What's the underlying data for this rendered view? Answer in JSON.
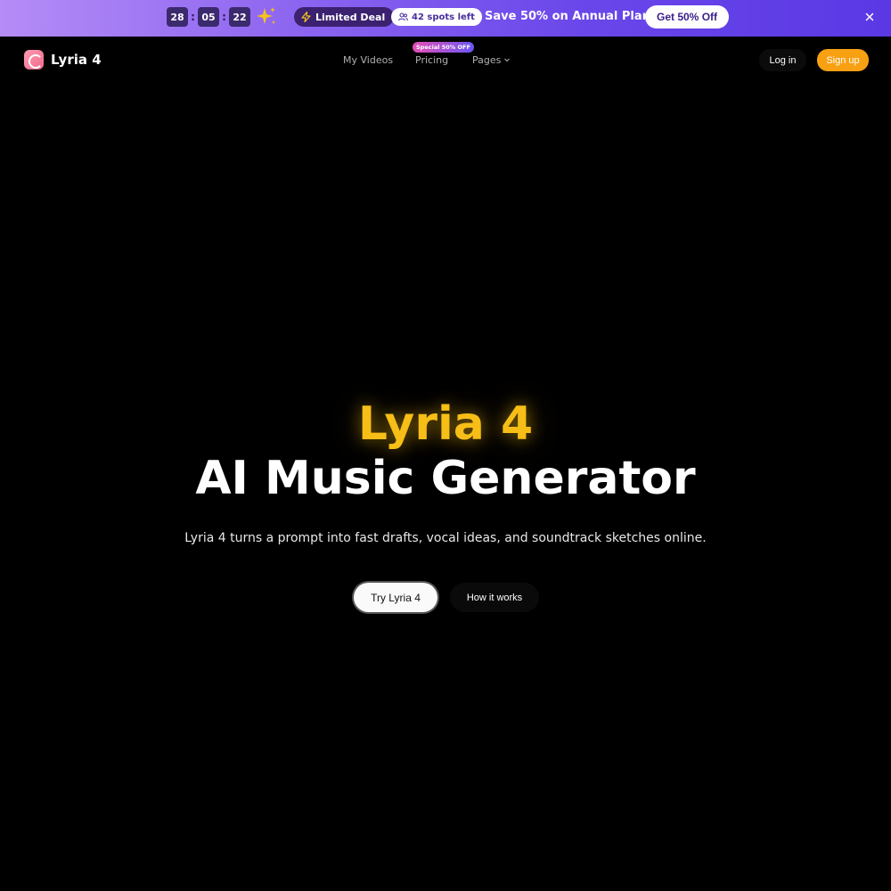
{
  "promo": {
    "timer": {
      "hours": "28",
      "minutes": "05",
      "seconds": "22",
      "separator": ":"
    },
    "deal_label": "Limited Deal",
    "spots_label": "42 spots left",
    "headline": "Save 50% on Annual Plans",
    "cta_label": "Get 50% Off",
    "icons": {
      "sparkle": "sparkle-icon",
      "bolt": "bolt-icon",
      "users": "users-icon",
      "close": "close-icon"
    },
    "colors": {
      "sparkle": "#f7c21b",
      "gradient_start": "#b58cf6",
      "gradient_end": "#5a38e4"
    }
  },
  "nav": {
    "brand": "Lyria 4",
    "links": {
      "my_videos": "My Videos",
      "pricing": "Pricing",
      "pricing_badge": "Special 50% OFF",
      "pages": "Pages"
    },
    "login_label": "Log in",
    "signup_label": "Sign up",
    "colors": {
      "signup": "#f7a012"
    }
  },
  "hero": {
    "brand_line": "Lyria 4",
    "title": "AI Music Generator",
    "subtitle": "Lyria 4 turns a prompt into fast drafts, vocal ideas, and soundtrack sketches online.",
    "primary_cta": "Try Lyria 4",
    "secondary_cta": "How it works",
    "colors": {
      "brand_line": "#f6be16"
    }
  }
}
